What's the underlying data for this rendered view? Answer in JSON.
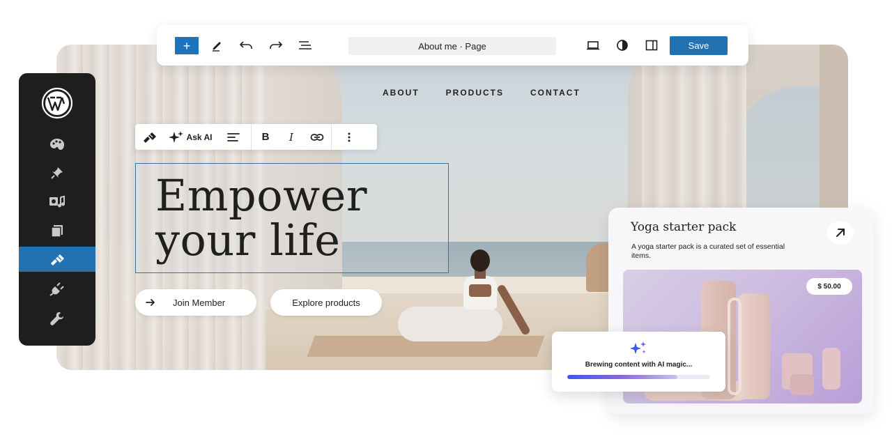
{
  "topbar": {
    "add_label": "+",
    "document_title": "About me · Page",
    "save_label": "Save"
  },
  "block_toolbar": {
    "ask_ai_label": "Ask AI",
    "bold_label": "B",
    "italic_label": "I"
  },
  "hero": {
    "nav": [
      "ABOUT",
      "PRODUCTS",
      "CONTACT"
    ],
    "headline": "Empower\nyour life",
    "primary_cta": "Join Member",
    "secondary_cta": "Explore products"
  },
  "product_card": {
    "title": "Yoga starter pack",
    "description": "A yoga starter pack is a curated set of essential items.",
    "price": "$ 50.00"
  },
  "ai_status": {
    "text": "Brewing content with AI magic...",
    "progress": 0.77
  },
  "colors": {
    "accent": "#2271b1",
    "selection_border": "#3a6fb0",
    "sidebar_bg": "#1e1e1e",
    "ai_gradient_start": "#3858e9",
    "ai_gradient_end": "#8b6ad8"
  },
  "icons": {
    "topbar": [
      "plus-icon",
      "pencil-icon",
      "undo-icon",
      "redo-icon",
      "list-view-icon",
      "desktop-preview-icon",
      "contrast-icon",
      "sidebar-toggle-icon"
    ],
    "sidebar": [
      "wordpress-logo",
      "palette-icon",
      "pin-icon",
      "media-icon",
      "pages-icon",
      "appearance-brush-icon",
      "plugins-icon",
      "tools-icon"
    ],
    "block_toolbar": [
      "brush-icon",
      "sparkles-icon",
      "align-icon",
      "bold-icon",
      "italic-icon",
      "link-icon",
      "more-vertical-icon"
    ]
  }
}
